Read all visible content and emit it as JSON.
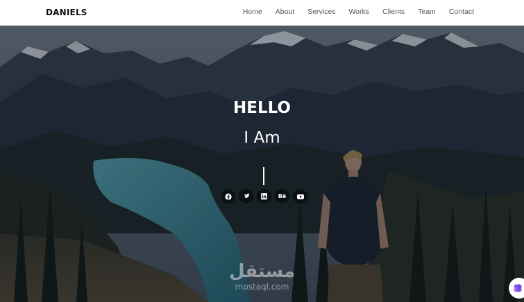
{
  "brand": "DANIELS",
  "nav": [
    "Home",
    "About",
    "Services",
    "Works",
    "Clients",
    "Team",
    "Contact"
  ],
  "hero": {
    "greeting": "HELLO",
    "intro": "I Am"
  },
  "socials": [
    {
      "icon": "facebook-icon"
    },
    {
      "icon": "twitter-icon"
    },
    {
      "icon": "linkedin-icon"
    },
    {
      "icon": "behance-icon",
      "label": "Bē"
    },
    {
      "icon": "youtube-icon"
    }
  ],
  "watermark": {
    "arabic": "مستقل",
    "url": "mostaql.com"
  },
  "colors": {
    "overlay": "#0b1420",
    "lake": "#3f8a98",
    "accent_widget": "#8a56e8"
  }
}
